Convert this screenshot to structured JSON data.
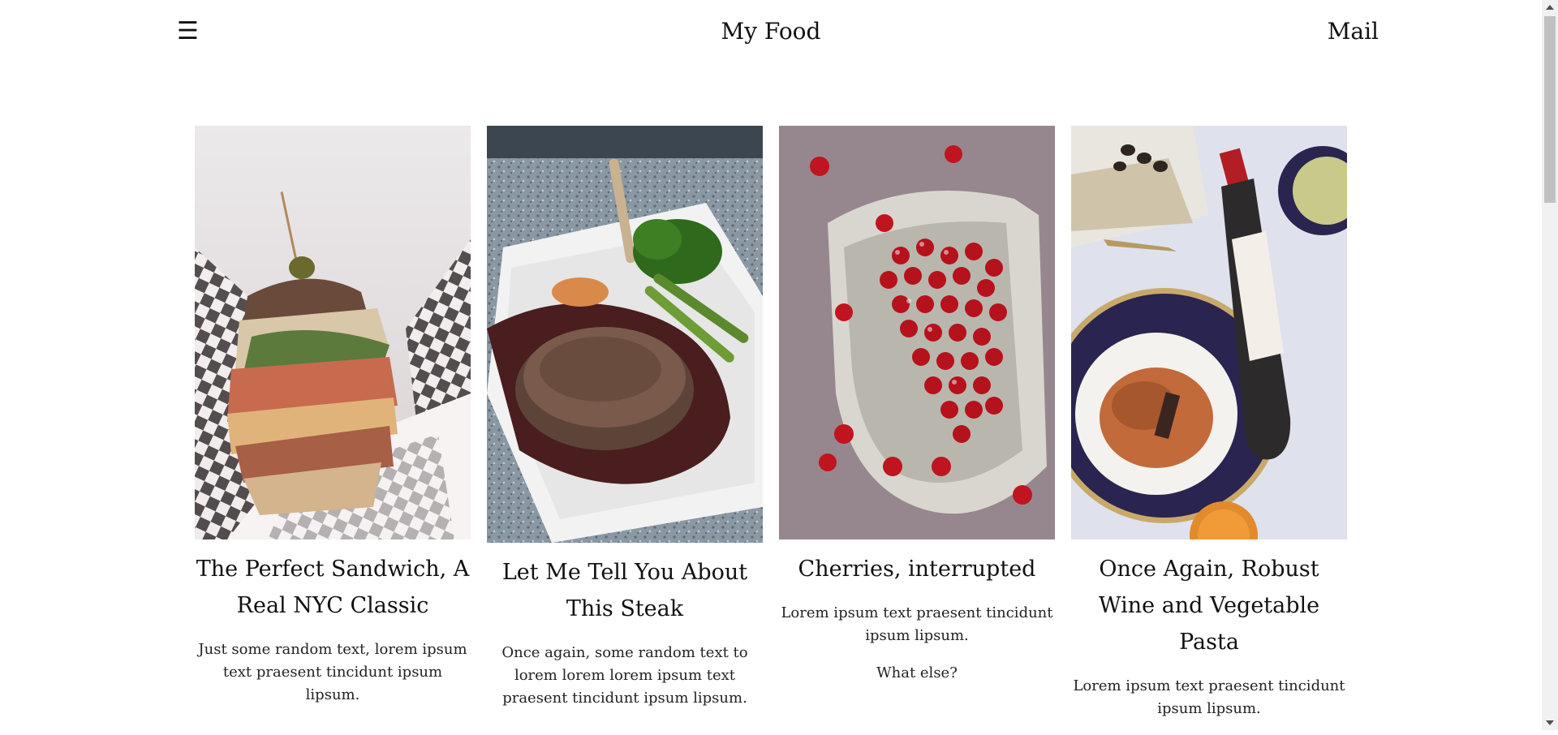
{
  "header": {
    "menu_icon": "☰",
    "title": "My Food",
    "mail_label": "Mail"
  },
  "cards": [
    {
      "image": "sandwich-photo",
      "title": "The Perfect Sandwich, A Real NYC Classic",
      "paragraphs": [
        "Just some random text, lorem ipsum text praesent tincidunt ipsum lipsum."
      ]
    },
    {
      "image": "steak-photo",
      "title": "Let Me Tell You About This Steak",
      "paragraphs": [
        "Once again, some random text to lorem lorem lorem ipsum text praesent tincidunt ipsum lipsum."
      ]
    },
    {
      "image": "cherries-photo",
      "title": "Cherries, interrupted",
      "paragraphs": [
        "Lorem ipsum text praesent tincidunt ipsum lipsum.",
        "What else?"
      ]
    },
    {
      "image": "wine-pasta-photo",
      "title": "Once Again, Robust Wine and Vegetable Pasta",
      "paragraphs": [
        "Lorem ipsum text praesent tincidunt ipsum lipsum."
      ]
    }
  ],
  "colors": {
    "background": "#ffffff",
    "text": "#111111",
    "scrollbar_track": "#f1f1f1",
    "scrollbar_thumb": "#c1c1c1"
  }
}
